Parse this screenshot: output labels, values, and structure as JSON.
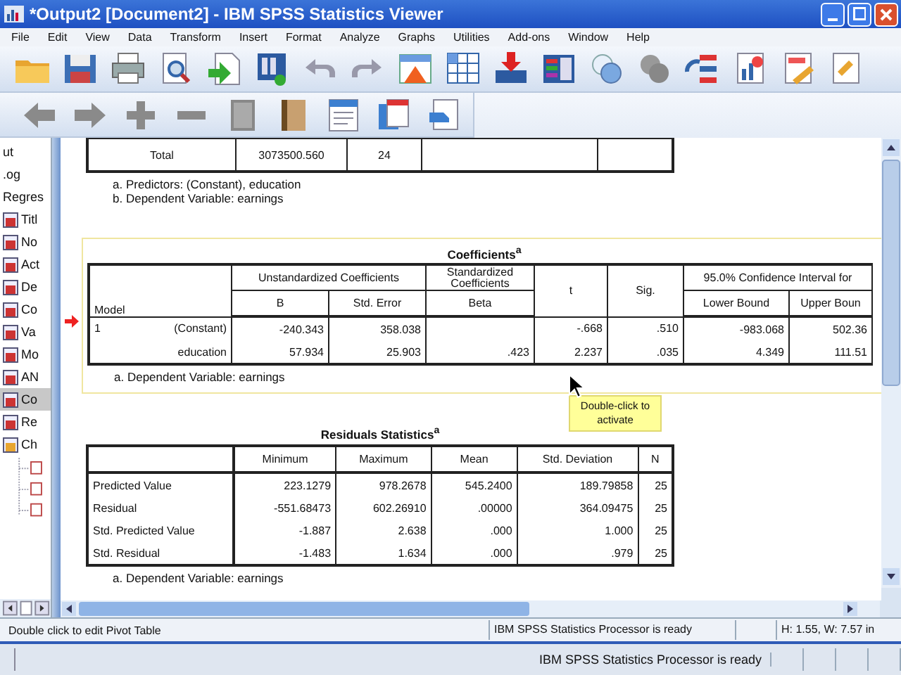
{
  "window": {
    "title": "*Output2 [Document2] - IBM SPSS Statistics Viewer"
  },
  "menu": [
    "File",
    "Edit",
    "View",
    "Data",
    "Transform",
    "Insert",
    "Format",
    "Analyze",
    "Graphs",
    "Utilities",
    "Add-ons",
    "Window",
    "Help"
  ],
  "outline": {
    "items": [
      {
        "label": "ut",
        "selected": false
      },
      {
        "label": ".og",
        "selected": false
      },
      {
        "label": "Regres",
        "selected": false
      },
      {
        "label": "Titl",
        "selected": false
      },
      {
        "label": "No",
        "selected": false
      },
      {
        "label": "Act",
        "selected": false
      },
      {
        "label": "De",
        "selected": false
      },
      {
        "label": "Co",
        "selected": false
      },
      {
        "label": "Va",
        "selected": false
      },
      {
        "label": "Mo",
        "selected": false
      },
      {
        "label": "AN",
        "selected": false
      },
      {
        "label": "Co",
        "selected": true
      },
      {
        "label": "Re",
        "selected": false
      },
      {
        "label": "Ch",
        "selected": false
      }
    ]
  },
  "anova_tail": {
    "cells": [
      "Total",
      "3073500.560",
      "24"
    ],
    "footnotes": [
      "a. Predictors: (Constant), education",
      "b. Dependent Variable: earnings"
    ]
  },
  "coefficients": {
    "title": "Coefficients$^{a}$",
    "selected": true,
    "model_header": "Model",
    "headers": [
      {
        "group": "Unstandardized Coefficients",
        "labels": [
          "B",
          "Std. Error"
        ]
      },
      {
        "group": "Standardized Coefficients",
        "labels": [
          "Beta"
        ]
      },
      {
        "labels": [
          "t"
        ]
      },
      {
        "labels": [
          "Sig."
        ]
      },
      {
        "group": "95.0% Confidence Interval for",
        "labels": [
          "Lower Bound",
          "Upper Boun"
        ]
      }
    ],
    "rows": [
      {
        "model": "1",
        "predictor": "(Constant)",
        "b": "-240.343",
        "std_error": "358.038",
        "t": "-.668",
        "sig": ".510",
        "lower": "-983.068",
        "upper": "502.36"
      },
      {
        "predictor": "education",
        "b": "57.934",
        "std_error": "25.903",
        "beta": ".423",
        "t": "2.237",
        "sig": ".035",
        "lower": "4.349",
        "upper": "111.51"
      }
    ],
    "footnote": "a. Dependent Variable: earnings"
  },
  "tooltip": {
    "text": "Double-click to activate"
  },
  "residuals": {
    "title": "Residuals Statistics$^{a}$",
    "columns": [
      "Minimum",
      "Maximum",
      "Mean",
      "Std. Deviation",
      "N"
    ],
    "rows": [
      {
        "label": "Predicted Value",
        "values": [
          "223.1279",
          "978.2678",
          "545.2400",
          "189.79858",
          "25"
        ]
      },
      {
        "label": "Residual",
        "values": [
          "-551.68473",
          "602.26910",
          ".00000",
          "364.09475",
          "25"
        ]
      },
      {
        "label": "Std. Predicted Value",
        "values": [
          "-1.887",
          "2.638",
          ".000",
          "1.000",
          "25"
        ]
      },
      {
        "label": "Std. Residual",
        "values": [
          "-1.483",
          "1.634",
          ".000",
          ".979",
          "25"
        ]
      }
    ],
    "footnote": "a. Dependent Variable: earnings"
  },
  "status_bar": {
    "message": "Double click to edit Pivot Table",
    "processor": "IBM SPSS Statistics Processor is ready",
    "size": "H: 1.55, W: 7.57 in"
  },
  "taskbar": {
    "processor": "IBM SPSS Statistics Processor is ready"
  }
}
